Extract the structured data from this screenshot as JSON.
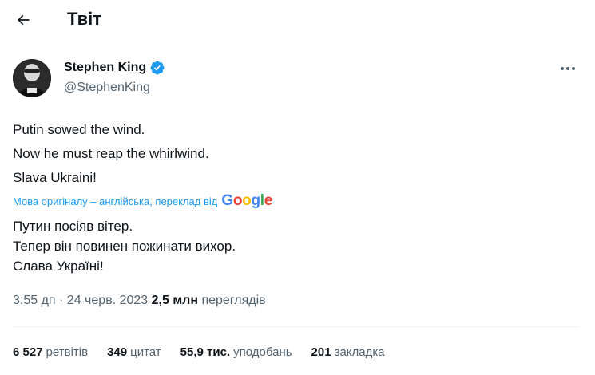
{
  "header": {
    "title": "Твіт"
  },
  "author": {
    "name": "Stephen King",
    "handle": "@StephenKing"
  },
  "tweet": {
    "lines": [
      "Putin sowed the wind.",
      "Now he must reap the whirlwind.",
      "Slava Ukraini!"
    ]
  },
  "translation": {
    "note": "Мова оригіналу – англійська, переклад від",
    "provider": {
      "g1": "G",
      "o1": "o",
      "o2": "o",
      "g2": "g",
      "l": "l",
      "e": "e"
    },
    "lines": [
      "Путин посіяв вітер.",
      "Тепер він повинен пожинати вихор.",
      "Слава Україні!"
    ]
  },
  "meta": {
    "time": "3:55 дп",
    "separator": " · ",
    "date": "24 черв. 2023",
    "views_count": "2,5 млн",
    "views_label": "переглядів"
  },
  "stats": {
    "retweets": {
      "count": "6 527",
      "label": "ретвітів"
    },
    "quotes": {
      "count": "349",
      "label": "цитат"
    },
    "likes": {
      "count": "55,9 тис.",
      "label": "уподобань"
    },
    "bookmarks": {
      "count": "201",
      "label": "закладка"
    }
  },
  "colors": {
    "accent": "#1d9bf0",
    "text": "#0f1419",
    "secondary": "#536471"
  }
}
